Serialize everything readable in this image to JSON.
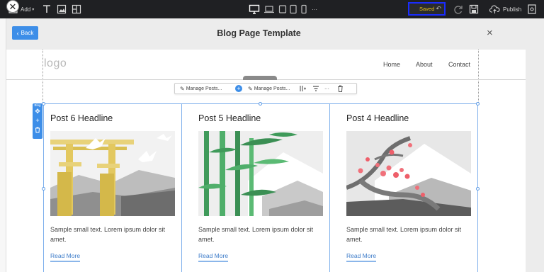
{
  "toolbar": {
    "add_label": "Add",
    "saved_label": "Saved",
    "publish_label": "Publish",
    "more_label": "···",
    "icons": [
      "pages-icon",
      "text-icon",
      "image-icon",
      "layout-icon",
      "desktop-icon",
      "laptop-icon",
      "tablet-icon",
      "tablet-small-icon",
      "mobile-icon",
      "undo-icon",
      "redo-icon",
      "save-icon",
      "upload-icon",
      "preview-icon"
    ]
  },
  "dialog": {
    "back_label": "Back",
    "title": "Blog Page Template",
    "close_symbol": "×"
  },
  "site": {
    "logo": "logo",
    "nav": [
      "Home",
      "About",
      "Contact"
    ]
  },
  "element_toolbar": {
    "items": [
      "Manage Posts...",
      "Manage Posts..."
    ],
    "more": "···"
  },
  "blog_widget": {
    "tag": "Blog",
    "posts": [
      {
        "headline": "Post 6 Headline",
        "text": "Sample small text. Lorem ipsum dolor sit amet.",
        "link": "Read More",
        "image": "torii-gate-illustration"
      },
      {
        "headline": "Post 5 Headline",
        "text": "Sample small text. Lorem ipsum dolor sit amet.",
        "link": "Read More",
        "image": "bamboo-illustration"
      },
      {
        "headline": "Post 4 Headline",
        "text": "Sample small text. Lorem ipsum dolor sit amet.",
        "link": "Read More",
        "image": "cherry-blossom-mountain-illustration"
      }
    ]
  },
  "colors": {
    "toolbar_bg": "#1f2023",
    "accent_blue": "#3d8ee8",
    "saved_text": "#e6c21a",
    "highlight_border": "#1a2cff"
  }
}
